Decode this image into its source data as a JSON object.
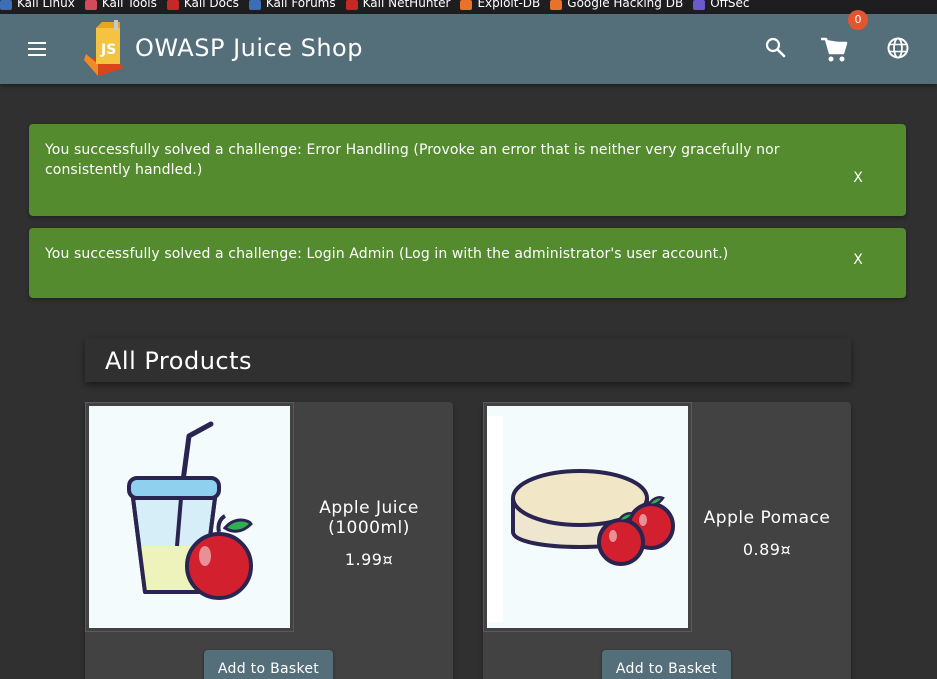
{
  "bookmarks": [
    {
      "label": "Kali Linux",
      "icon": "kali-dragon-icon",
      "color": "#3d6eb3"
    },
    {
      "label": "Kali Tools",
      "icon": "kali-tools-icon",
      "color": "#d24b5a"
    },
    {
      "label": "Kali Docs",
      "icon": "kali-docs-icon",
      "color": "#c62828"
    },
    {
      "label": "Kali Forums",
      "icon": "kali-forums-icon",
      "color": "#3d6eb3"
    },
    {
      "label": "Kali NetHunter",
      "icon": "nethunter-icon",
      "color": "#c62828"
    },
    {
      "label": "Exploit-DB",
      "icon": "exploit-db-icon",
      "color": "#e8712c"
    },
    {
      "label": "Google Hacking DB",
      "icon": "ghdb-icon",
      "color": "#e8712c"
    },
    {
      "label": "OffSec",
      "icon": "offsec-icon",
      "color": "#6a5acd"
    }
  ],
  "toolbar": {
    "title": "OWASP Juice Shop",
    "cart_count": "0",
    "color": "#546e7a"
  },
  "notifications": [
    {
      "message": "You successfully solved a challenge: Error Handling (Provoke an error that is neither very gracefully nor consistently handled.)",
      "close_label": "X"
    },
    {
      "message": "You successfully solved a challenge: Login Admin (Log in with the administrator's user account.)",
      "close_label": "X"
    }
  ],
  "products": {
    "heading": "All Products",
    "items": [
      {
        "name": "Apple Juice (1000ml)",
        "price": "1.99¤",
        "button": "Add to Basket"
      },
      {
        "name": "Apple Pomace",
        "price": "0.89¤",
        "button": "Add to Basket"
      }
    ]
  }
}
